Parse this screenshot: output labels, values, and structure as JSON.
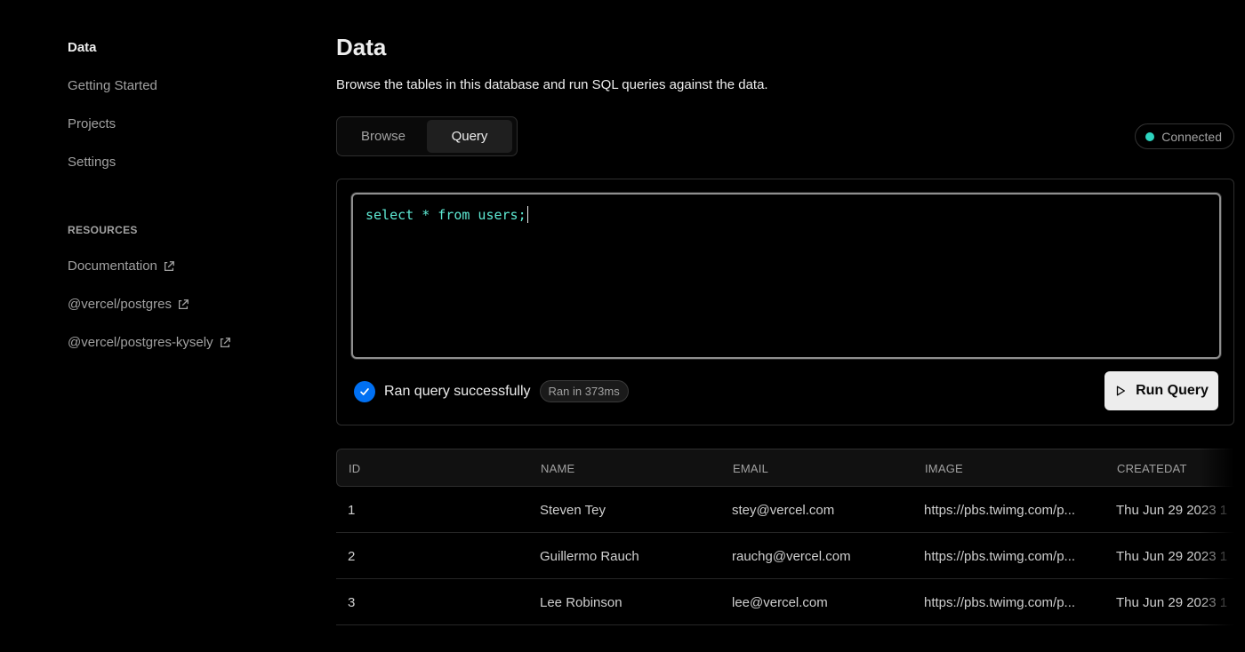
{
  "sidebar": {
    "items": [
      {
        "label": "Data",
        "active": true
      },
      {
        "label": "Getting Started"
      },
      {
        "label": "Projects"
      },
      {
        "label": "Settings"
      }
    ],
    "resources_label": "RESOURCES",
    "resources": [
      {
        "label": "Documentation",
        "icon": "external-link-icon"
      },
      {
        "label": "@vercel/postgres",
        "icon": "external-link-icon"
      },
      {
        "label": "@vercel/postgres-kysely",
        "icon": "external-link-icon"
      }
    ]
  },
  "header": {
    "title": "Data",
    "description": "Browse the tables in this database and run SQL queries against the data."
  },
  "tabs": [
    {
      "label": "Browse"
    },
    {
      "label": "Query",
      "selected": true
    }
  ],
  "status": {
    "label": "Connected",
    "color": "#2dd4bf"
  },
  "editor": {
    "code": "select * from users;"
  },
  "result": {
    "message": "Ran query successfully",
    "timing": "Ran in 373ms",
    "icon": "check-circle-icon",
    "color": "#0070f3"
  },
  "run_button": {
    "label": "Run Query",
    "icon": "play-icon"
  },
  "table": {
    "columns": [
      "ID",
      "NAME",
      "EMAIL",
      "IMAGE",
      "CREATEDAT"
    ],
    "rows": [
      [
        "1",
        "Steven Tey",
        "stey@vercel.com",
        "https://pbs.twimg.com/p...",
        "Thu Jun 29 2023 1"
      ],
      [
        "2",
        "Guillermo Rauch",
        "rauchg@vercel.com",
        "https://pbs.twimg.com/p...",
        "Thu Jun 29 2023 1"
      ],
      [
        "3",
        "Lee Robinson",
        "lee@vercel.com",
        "https://pbs.twimg.com/p...",
        "Thu Jun 29 2023 1"
      ]
    ]
  }
}
